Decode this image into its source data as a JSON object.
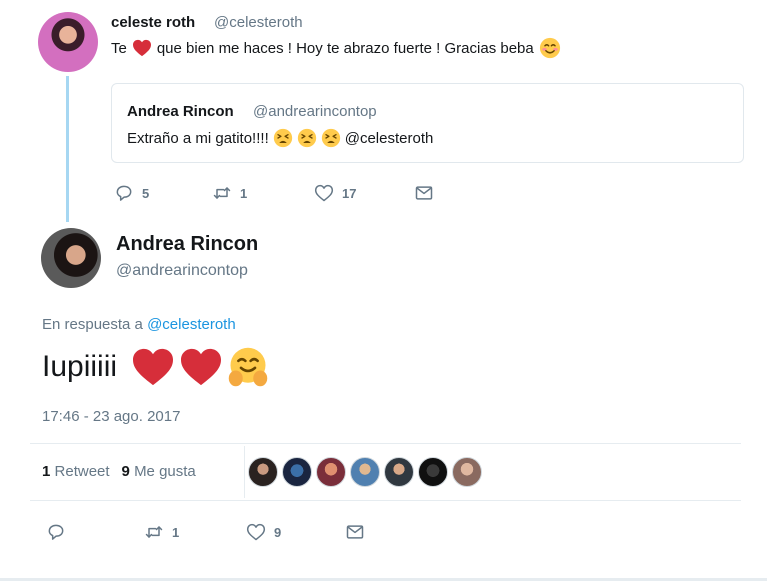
{
  "tweet1": {
    "name": "celeste roth",
    "handle": "@celesteroth",
    "text_before": "Te",
    "text_after": "que bien me haces ! Hoy te abrazo fuerte ! Gracias beba",
    "text_icons": [
      "heart-icon",
      "smiling-face-icon"
    ],
    "quoted": {
      "name": "Andrea Rincon",
      "handle": "@andrearincontop",
      "text": "Extraño a mi gatito!!!!",
      "mention": "@celesteroth",
      "text_icons": [
        "tired-face-icon",
        "tired-face-icon",
        "tired-face-icon"
      ]
    },
    "actions": {
      "reply_count": "5",
      "retweet_count": "1",
      "like_count": "17"
    }
  },
  "tweet2": {
    "name": "Andrea Rincon",
    "handle": "@andrearincontop",
    "reply_prefix": "En respuesta a",
    "reply_to": "@celesteroth",
    "text": "Iupiiiii",
    "text_icons": [
      "heart-icon",
      "heart-icon",
      "hugging-face-icon"
    ],
    "timestamp": "17:46 - 23 ago. 2017",
    "stats": {
      "retweets_count": "1",
      "retweets_label": "Retweet",
      "likes_count": "9",
      "likes_label": "Me gusta"
    },
    "liker_avatars": 7,
    "actions": {
      "retweet_count": "1",
      "like_count": "9"
    }
  },
  "colors": {
    "link": "#1b95e0",
    "muted": "#657786",
    "thread_line": "#a6d7f2",
    "heart": "#d62e3a"
  }
}
